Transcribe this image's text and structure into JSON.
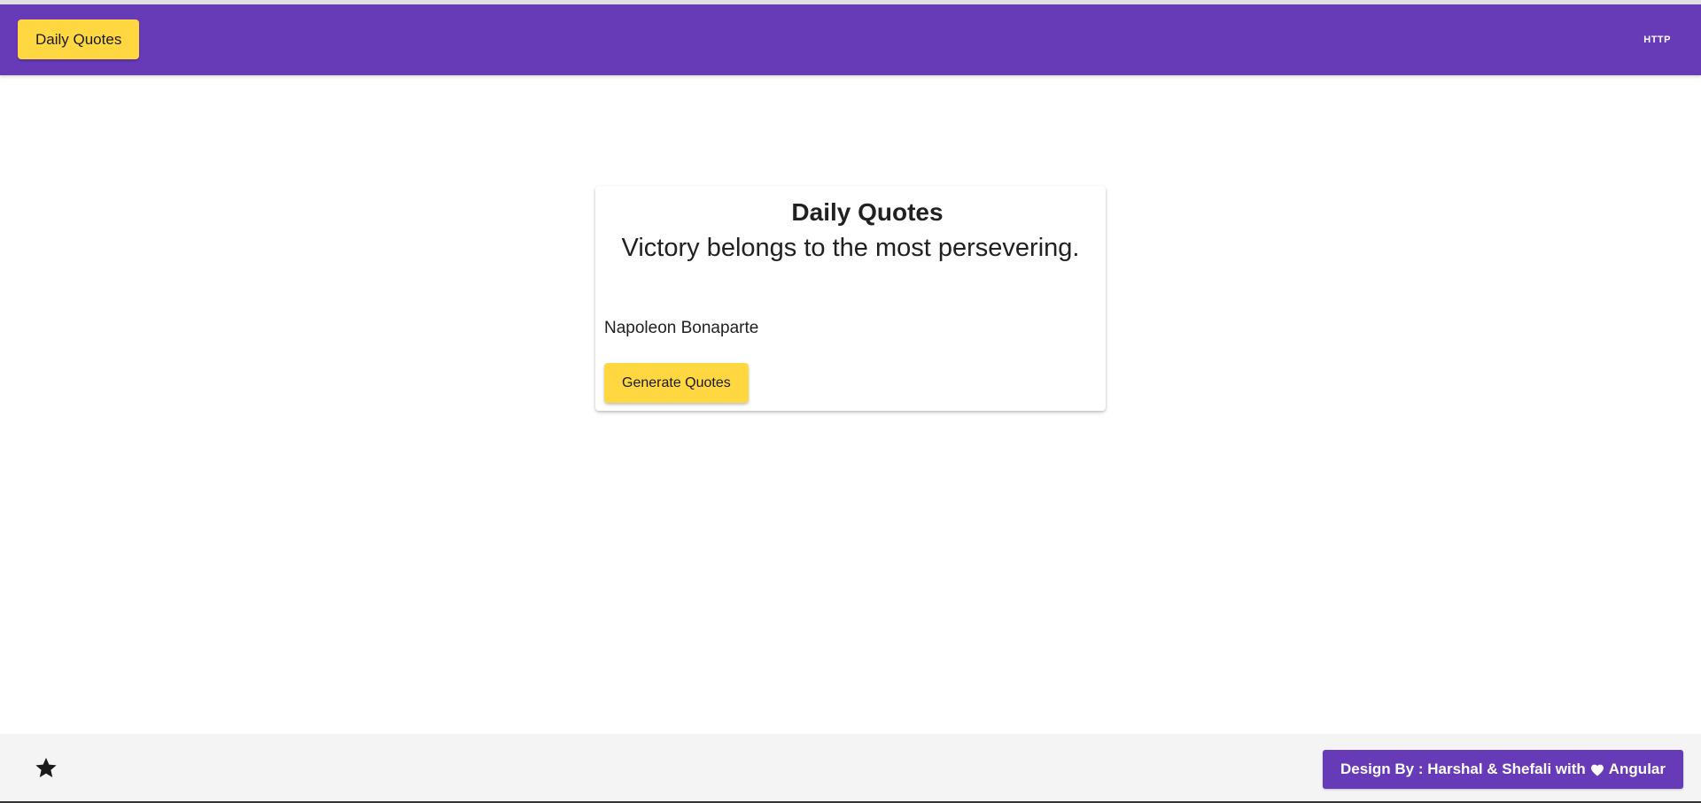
{
  "toolbar": {
    "brand_label": "Daily Quotes",
    "http_label": "HTTP"
  },
  "card": {
    "title": "Daily Quotes",
    "quote": "Victory belongs to the most persevering.",
    "author": "Napoleon Bonaparte",
    "button_label": "Generate Quotes"
  },
  "footer": {
    "star_icon": "star-icon",
    "credit_prefix": "Design By : Harshal & Shefali with",
    "heart_icon": "heart-icon",
    "credit_suffix": "Angular"
  },
  "colors": {
    "primary": "#673ab7",
    "accent": "#ffd740",
    "footer_bg": "#f4f4f4"
  }
}
